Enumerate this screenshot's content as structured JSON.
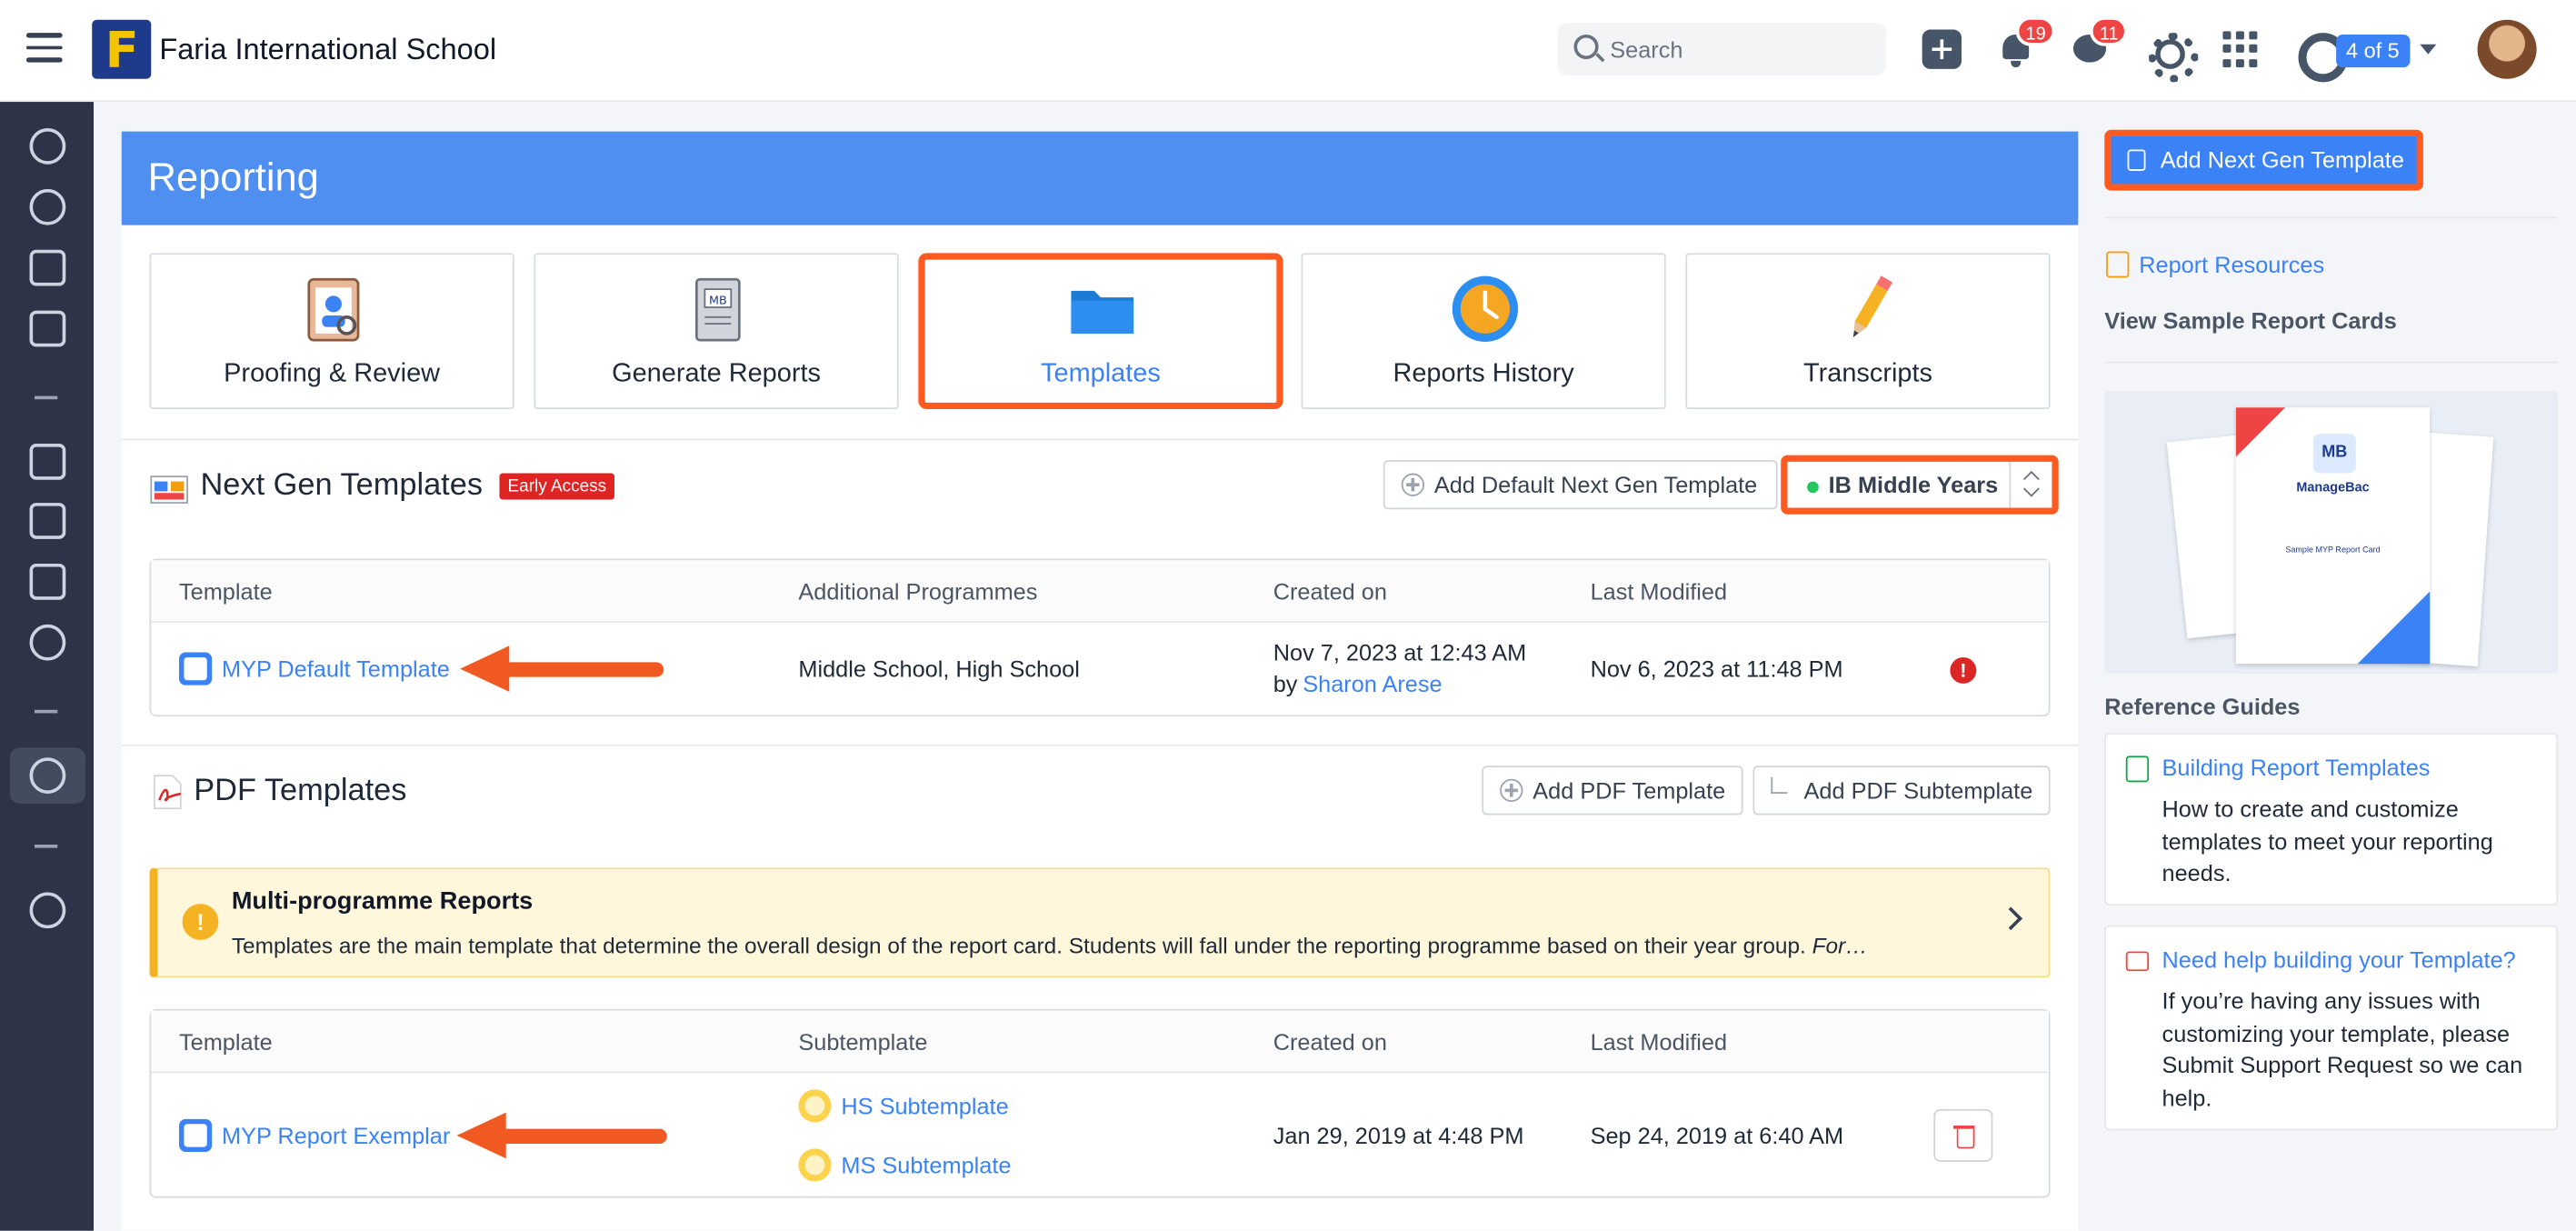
{
  "topbar": {
    "school_name": "Faria International School",
    "search_placeholder": "Search",
    "notifications_count": "19",
    "messages_count": "11",
    "pagination_label": "4 of 5"
  },
  "page": {
    "title": "Reporting"
  },
  "tiles": [
    {
      "label": "Proofing & Review",
      "selected": false
    },
    {
      "label": "Generate Reports",
      "selected": false
    },
    {
      "label": "Templates",
      "selected": true
    },
    {
      "label": "Reports History",
      "selected": false
    },
    {
      "label": "Transcripts",
      "selected": false
    }
  ],
  "next_gen": {
    "title": "Next Gen Templates",
    "badge": "Early Access",
    "add_default_button": "Add Default Next Gen Template",
    "programme_selected": "IB Middle Years",
    "columns": [
      "Template",
      "Additional Programmes",
      "Created on",
      "Last Modified"
    ],
    "rows": [
      {
        "template": "MYP Default Template",
        "additional_programmes": "Middle School, High School",
        "created_on": "Nov 7, 2023 at 12:43 AM",
        "created_by_prefix": "by",
        "created_by": "Sharon Arese",
        "last_modified": "Nov 6, 2023 at 11:48 PM"
      }
    ]
  },
  "pdf": {
    "title": "PDF Templates",
    "add_pdf_button": "Add PDF Template",
    "add_pdf_sub_button": "Add PDF Subtemplate",
    "notice_title": "Multi-programme Reports",
    "notice_body": "Templates are the main template that determine the overall design of the report card. Students will fall under the reporting programme based on their year group.",
    "notice_body_italic": "For…",
    "columns": [
      "Template",
      "Subtemplate",
      "Created on",
      "Last Modified"
    ],
    "rows": [
      {
        "template": "MYP Report Exemplar",
        "subtemplates": [
          "HS Subtemplate",
          "MS Subtemplate"
        ],
        "created_on": "Jan 29, 2019 at 4:48 PM",
        "last_modified": "Sep 24, 2019 at 6:40 AM"
      }
    ]
  },
  "right_panel": {
    "add_next_gen_button": "Add Next Gen Template",
    "report_resources": "Report Resources",
    "view_sample": "View Sample Report Cards",
    "sample_brand": "ManageBac",
    "sample_caption": "Sample MYP Report Card",
    "reference_guides": "Reference Guides",
    "guides": [
      {
        "title": "Building Report Templates",
        "body": "How to create and customize templates to meet your reporting needs."
      },
      {
        "title": "Need help building your Template?",
        "body": "If you’re having any issues with customizing your template, please Submit Support Request so we can help."
      }
    ]
  },
  "colors": {
    "accent": "#3b82f6",
    "banner": "#4f8ff0",
    "highlight": "#ff5a1f",
    "sidebar": "#2d3447"
  }
}
